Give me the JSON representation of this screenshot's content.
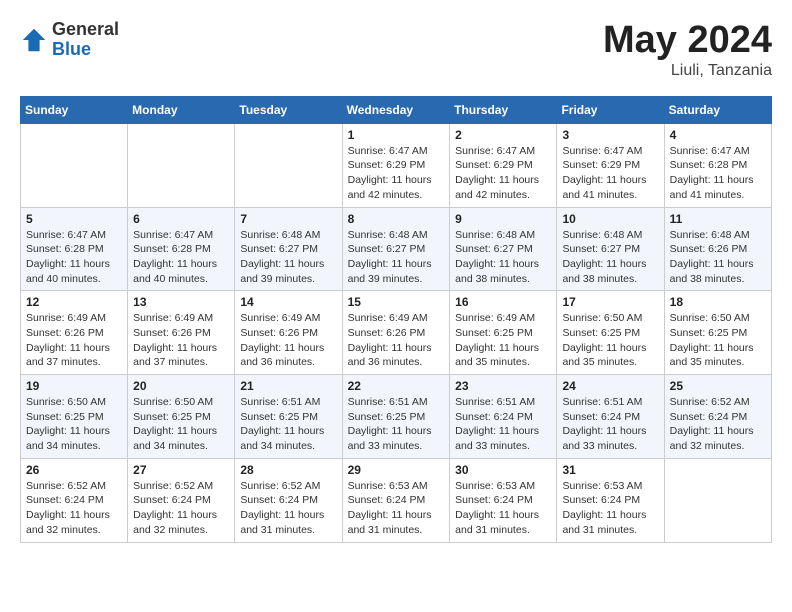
{
  "header": {
    "logo_general": "General",
    "logo_blue": "Blue",
    "month": "May 2024",
    "location": "Liuli, Tanzania"
  },
  "weekdays": [
    "Sunday",
    "Monday",
    "Tuesday",
    "Wednesday",
    "Thursday",
    "Friday",
    "Saturday"
  ],
  "weeks": [
    [
      null,
      null,
      null,
      {
        "day": 1,
        "sunrise": "6:47 AM",
        "sunset": "6:29 PM",
        "daylight": "11 hours and 42 minutes."
      },
      {
        "day": 2,
        "sunrise": "6:47 AM",
        "sunset": "6:29 PM",
        "daylight": "11 hours and 42 minutes."
      },
      {
        "day": 3,
        "sunrise": "6:47 AM",
        "sunset": "6:29 PM",
        "daylight": "11 hours and 41 minutes."
      },
      {
        "day": 4,
        "sunrise": "6:47 AM",
        "sunset": "6:28 PM",
        "daylight": "11 hours and 41 minutes."
      }
    ],
    [
      {
        "day": 5,
        "sunrise": "6:47 AM",
        "sunset": "6:28 PM",
        "daylight": "11 hours and 40 minutes."
      },
      {
        "day": 6,
        "sunrise": "6:47 AM",
        "sunset": "6:28 PM",
        "daylight": "11 hours and 40 minutes."
      },
      {
        "day": 7,
        "sunrise": "6:48 AM",
        "sunset": "6:27 PM",
        "daylight": "11 hours and 39 minutes."
      },
      {
        "day": 8,
        "sunrise": "6:48 AM",
        "sunset": "6:27 PM",
        "daylight": "11 hours and 39 minutes."
      },
      {
        "day": 9,
        "sunrise": "6:48 AM",
        "sunset": "6:27 PM",
        "daylight": "11 hours and 38 minutes."
      },
      {
        "day": 10,
        "sunrise": "6:48 AM",
        "sunset": "6:27 PM",
        "daylight": "11 hours and 38 minutes."
      },
      {
        "day": 11,
        "sunrise": "6:48 AM",
        "sunset": "6:26 PM",
        "daylight": "11 hours and 38 minutes."
      }
    ],
    [
      {
        "day": 12,
        "sunrise": "6:49 AM",
        "sunset": "6:26 PM",
        "daylight": "11 hours and 37 minutes."
      },
      {
        "day": 13,
        "sunrise": "6:49 AM",
        "sunset": "6:26 PM",
        "daylight": "11 hours and 37 minutes."
      },
      {
        "day": 14,
        "sunrise": "6:49 AM",
        "sunset": "6:26 PM",
        "daylight": "11 hours and 36 minutes."
      },
      {
        "day": 15,
        "sunrise": "6:49 AM",
        "sunset": "6:26 PM",
        "daylight": "11 hours and 36 minutes."
      },
      {
        "day": 16,
        "sunrise": "6:49 AM",
        "sunset": "6:25 PM",
        "daylight": "11 hours and 35 minutes."
      },
      {
        "day": 17,
        "sunrise": "6:50 AM",
        "sunset": "6:25 PM",
        "daylight": "11 hours and 35 minutes."
      },
      {
        "day": 18,
        "sunrise": "6:50 AM",
        "sunset": "6:25 PM",
        "daylight": "11 hours and 35 minutes."
      }
    ],
    [
      {
        "day": 19,
        "sunrise": "6:50 AM",
        "sunset": "6:25 PM",
        "daylight": "11 hours and 34 minutes."
      },
      {
        "day": 20,
        "sunrise": "6:50 AM",
        "sunset": "6:25 PM",
        "daylight": "11 hours and 34 minutes."
      },
      {
        "day": 21,
        "sunrise": "6:51 AM",
        "sunset": "6:25 PM",
        "daylight": "11 hours and 34 minutes."
      },
      {
        "day": 22,
        "sunrise": "6:51 AM",
        "sunset": "6:25 PM",
        "daylight": "11 hours and 33 minutes."
      },
      {
        "day": 23,
        "sunrise": "6:51 AM",
        "sunset": "6:24 PM",
        "daylight": "11 hours and 33 minutes."
      },
      {
        "day": 24,
        "sunrise": "6:51 AM",
        "sunset": "6:24 PM",
        "daylight": "11 hours and 33 minutes."
      },
      {
        "day": 25,
        "sunrise": "6:52 AM",
        "sunset": "6:24 PM",
        "daylight": "11 hours and 32 minutes."
      }
    ],
    [
      {
        "day": 26,
        "sunrise": "6:52 AM",
        "sunset": "6:24 PM",
        "daylight": "11 hours and 32 minutes."
      },
      {
        "day": 27,
        "sunrise": "6:52 AM",
        "sunset": "6:24 PM",
        "daylight": "11 hours and 32 minutes."
      },
      {
        "day": 28,
        "sunrise": "6:52 AM",
        "sunset": "6:24 PM",
        "daylight": "11 hours and 31 minutes."
      },
      {
        "day": 29,
        "sunrise": "6:53 AM",
        "sunset": "6:24 PM",
        "daylight": "11 hours and 31 minutes."
      },
      {
        "day": 30,
        "sunrise": "6:53 AM",
        "sunset": "6:24 PM",
        "daylight": "11 hours and 31 minutes."
      },
      {
        "day": 31,
        "sunrise": "6:53 AM",
        "sunset": "6:24 PM",
        "daylight": "11 hours and 31 minutes."
      },
      null
    ]
  ],
  "labels": {
    "sunrise": "Sunrise:",
    "sunset": "Sunset:",
    "daylight": "Daylight:"
  }
}
